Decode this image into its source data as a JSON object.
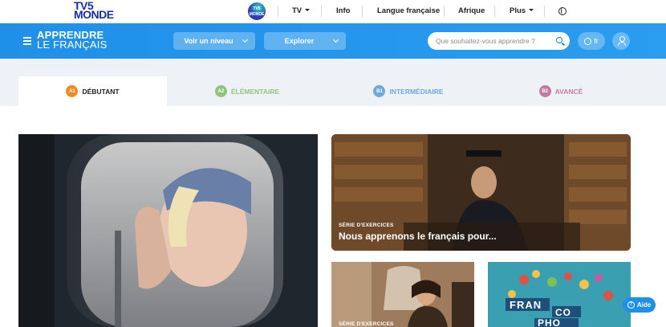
{
  "topnav": {
    "logo_line1": "TV5",
    "logo_line2": "MONDE",
    "channel_badge": "TV5 MONDE",
    "items": [
      {
        "label": "TV",
        "has_caret": true
      },
      {
        "label": "Info"
      },
      {
        "label": "Langue française"
      },
      {
        "label": "Afrique"
      },
      {
        "label": "Plus",
        "has_caret": true
      }
    ]
  },
  "header": {
    "brand_line1": "APPRENDRE",
    "brand_line2": "LE FRANÇAIS",
    "level_button": "Voir un niveau",
    "explore_button": "Explorer",
    "search_placeholder": "Que souhaitez-vous apprendre ?",
    "language": "fr"
  },
  "tabs": [
    {
      "badge": "A1",
      "label": "DÉBUTANT",
      "color": "#f08a24",
      "active": true
    },
    {
      "badge": "A2",
      "label": "ÉLÉMENTAIRE",
      "color": "#93c47d"
    },
    {
      "badge": "B1",
      "label": "INTERMÉDIAIRE",
      "color": "#6fa8dc"
    },
    {
      "badge": "B2",
      "label": "AVANCÉ",
      "color": "#c27ba0"
    }
  ],
  "cards": {
    "study": {
      "category": "SÉRIE D'EXERCICES",
      "title": "Nous apprenons le français pour..."
    },
    "woman": {
      "category": "SÉRIE D'EXERCICES"
    },
    "franco": {
      "art": [
        "FRAN",
        "CO",
        "PHO"
      ]
    }
  },
  "help": {
    "label": "Aide"
  },
  "colors": {
    "brand_blue": "#1f8fe8",
    "logo_navy": "#1a2f9e"
  }
}
